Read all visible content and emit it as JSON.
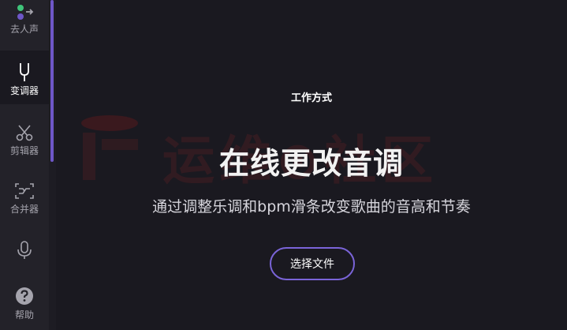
{
  "sidebar": {
    "accent_color": "#6e57c8",
    "items": [
      {
        "label": "去人声",
        "icon": "vocal-remover-icon"
      },
      {
        "label": "变调器",
        "icon": "tuning-fork-icon",
        "active": true
      },
      {
        "label": "剪辑器",
        "icon": "scissors-icon"
      },
      {
        "label": "合并器",
        "icon": "merge-icon"
      },
      {
        "label": "",
        "icon": "microphone-icon"
      },
      {
        "label": "帮助",
        "icon": "help-icon"
      }
    ]
  },
  "main": {
    "kicker": "工作方式",
    "title": "在线更改音调",
    "subtitle": "通过调整乐调和bpm滑条改变歌曲的音高和节奏",
    "select_button": "选择文件",
    "button_border_color": "#7a64d8",
    "watermark": "运维⊙社区"
  }
}
